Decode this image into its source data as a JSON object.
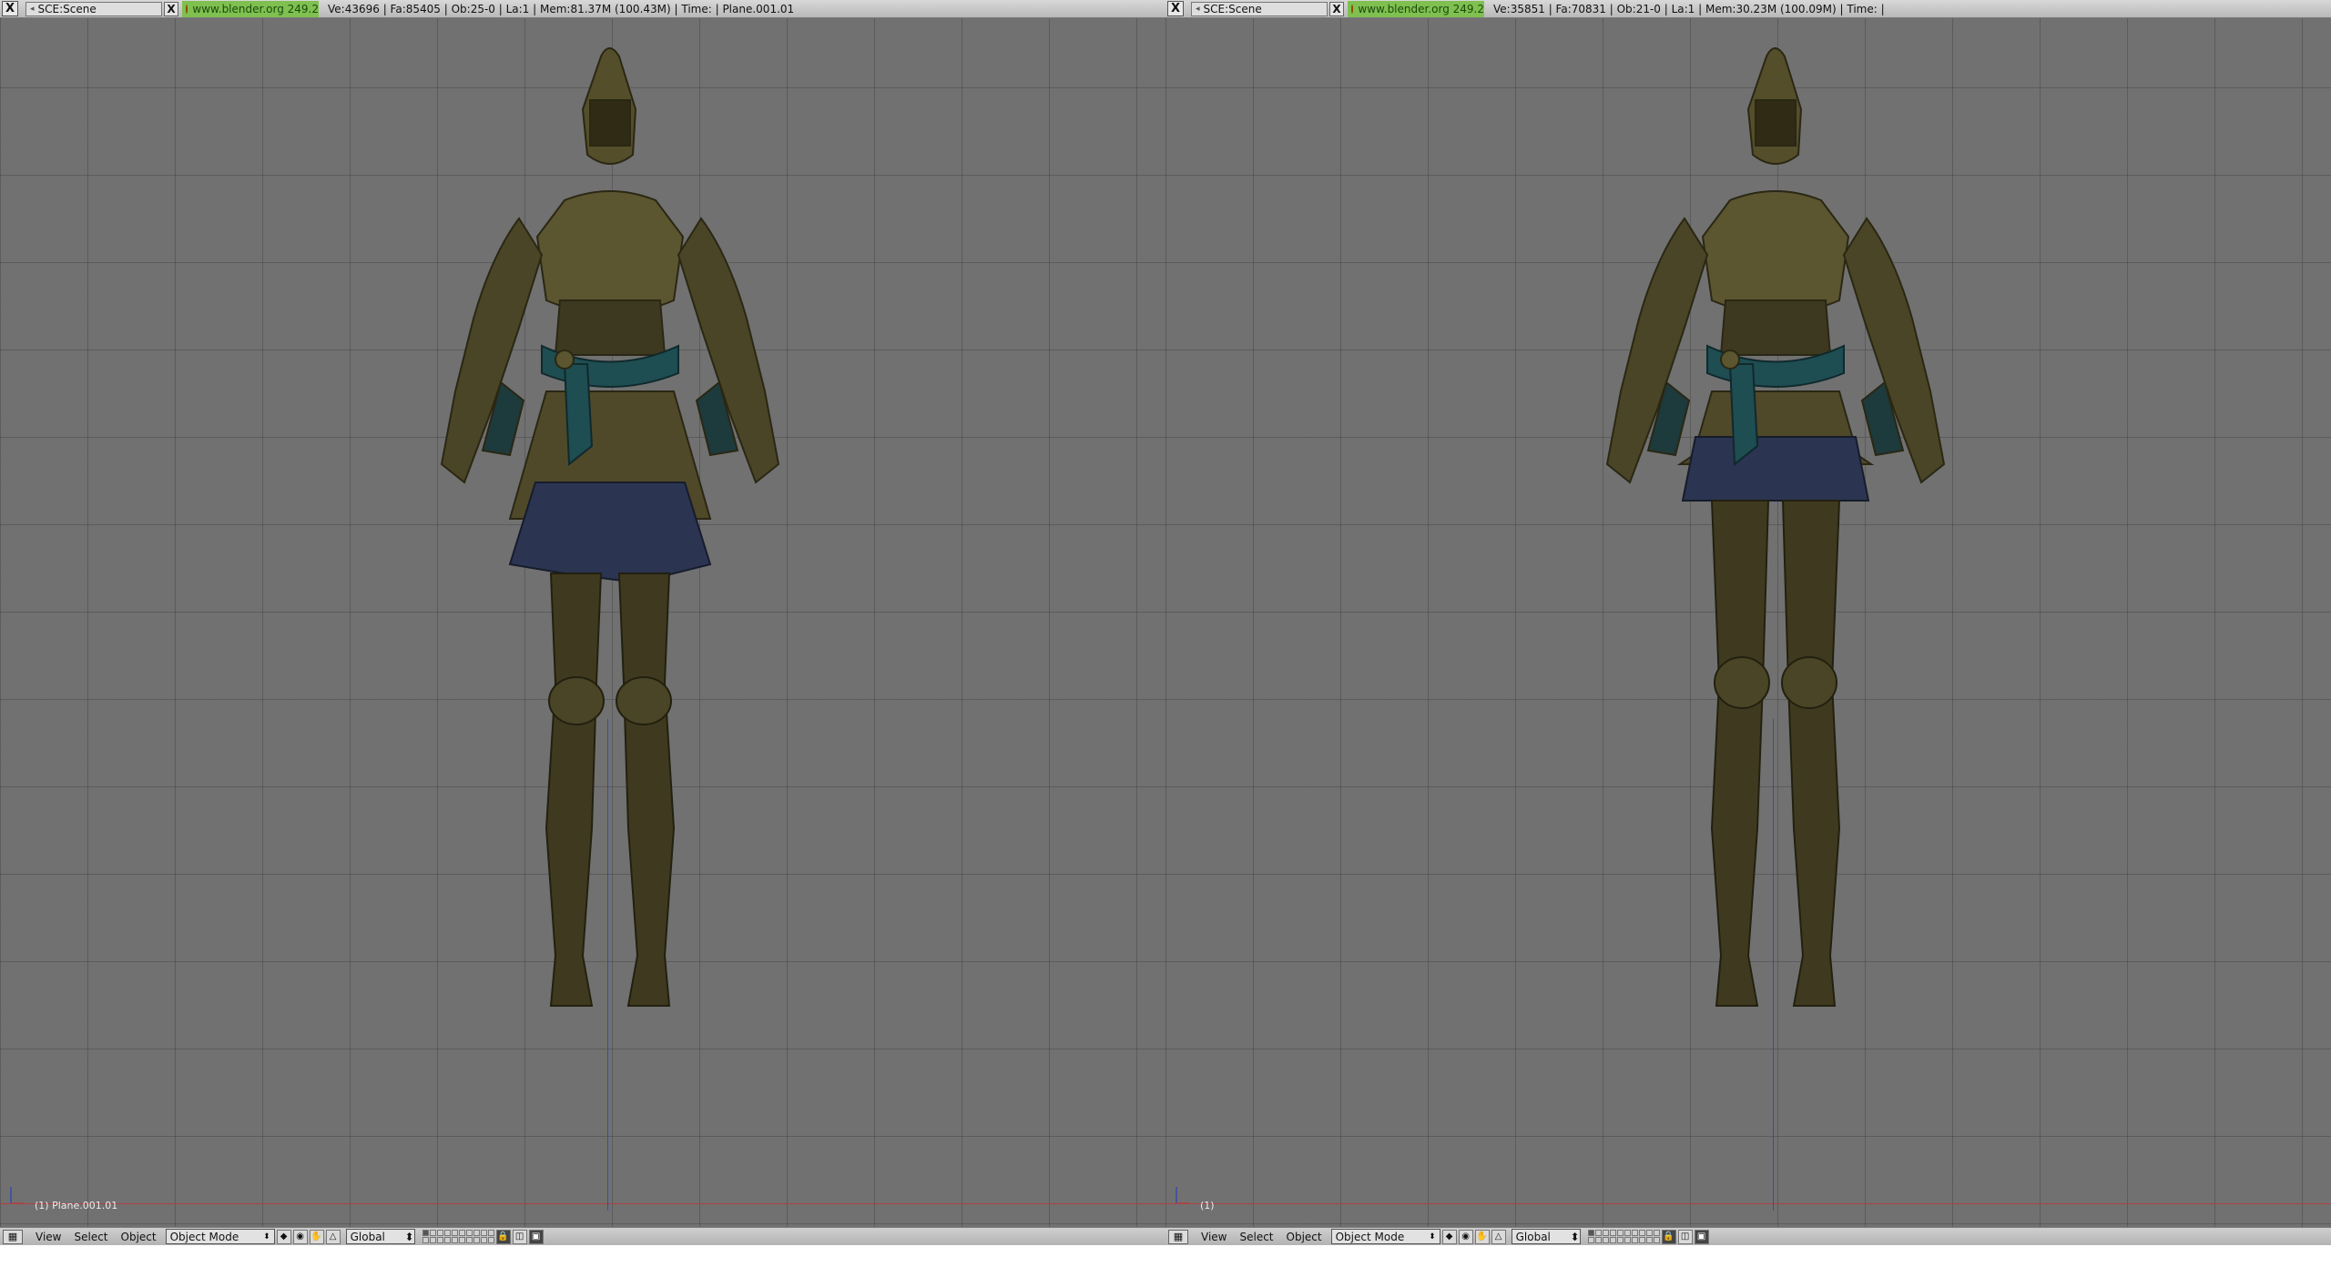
{
  "colors": {
    "viewport_bg": "#717171",
    "grid_line": "#555555",
    "url_bg": "#7fc050",
    "header_bg": "#c8c8c8",
    "armor_base": "#4a4526",
    "sash": "#1e4d52",
    "skirt": "#2b3450"
  },
  "panes": [
    {
      "header": {
        "close_glyph": "X",
        "scene_label": "SCE:Scene",
        "scene_close_glyph": "X",
        "url": "www.blender.org 249.2",
        "stats": "Ve:43696 | Fa:85405 | Ob:25-0 | La:1  | Mem:81.37M (100.43M)  | Time: | Plane.001.01"
      },
      "viewport": {
        "label": "(1) Plane.001.01",
        "model": "armored-knight-skirt-long"
      },
      "bottombar": {
        "menus": [
          "View",
          "Select",
          "Object"
        ],
        "mode": "Object Mode",
        "orientation": "Global"
      }
    },
    {
      "header": {
        "close_glyph": "X",
        "scene_label": "SCE:Scene",
        "scene_close_glyph": "X",
        "url": "www.blender.org 249.2",
        "stats": "Ve:35851 | Fa:70831 | Ob:21-0 | La:1  | Mem:30.23M (100.09M)  | Time: |"
      },
      "viewport": {
        "label": "(1)",
        "model": "armored-knight-skirt-short"
      },
      "bottombar": {
        "menus": [
          "View",
          "Select",
          "Object"
        ],
        "mode": "Object Mode",
        "orientation": "Global"
      }
    }
  ]
}
